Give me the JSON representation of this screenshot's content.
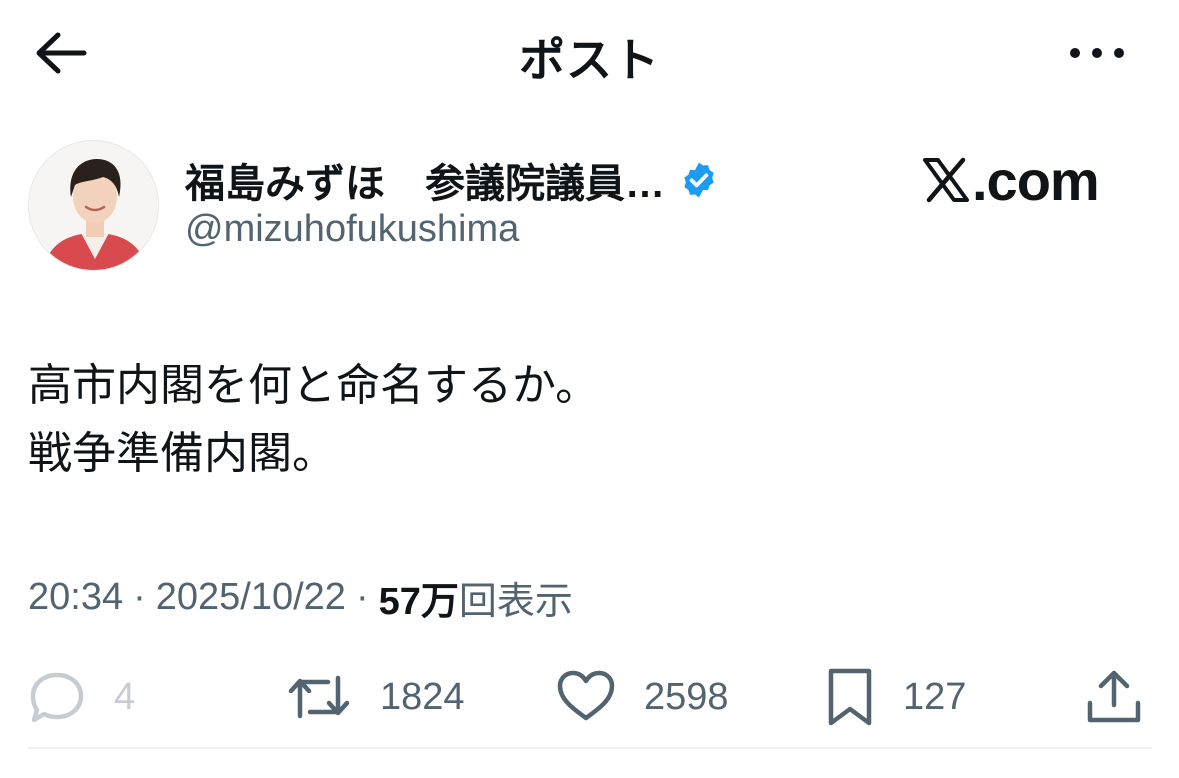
{
  "header": {
    "title": "ポスト",
    "back_icon": "arrow-left-icon",
    "more_icon": "more-horizontal-icon"
  },
  "author": {
    "display_name": "福島みずほ　参議院議員…",
    "handle": "@mizuhofukushima",
    "verified": true,
    "verified_color": "#1d9bf0"
  },
  "watermark": {
    "text": ".com",
    "icon": "x-logo-icon"
  },
  "tweet": {
    "lines": [
      "高市内閣を何と命名するか。",
      "戦争準備内閣。"
    ]
  },
  "meta": {
    "time": "20:34",
    "separator": "·",
    "date": "2025/10/22",
    "views_count": "57万",
    "views_label": "回表示"
  },
  "actions": {
    "reply_count": "4",
    "retweet_count": "1824",
    "like_count": "2598",
    "bookmark_count": "127"
  },
  "colors": {
    "text_primary": "#0f1419",
    "text_secondary": "#536471",
    "accent": "#1d9bf0"
  }
}
